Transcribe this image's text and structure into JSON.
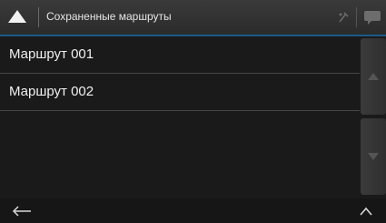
{
  "header": {
    "title": "Сохраненные маршруты",
    "icons": [
      "up-arrow-icon",
      "settings-tool-icon",
      "chat-bubble-icon"
    ]
  },
  "routes": [
    {
      "label": "Маршрут 001"
    },
    {
      "label": "Маршрут 002"
    }
  ],
  "footer": {
    "left_icon": "back-arrow-icon",
    "right_icon": "chevron-up-icon"
  },
  "colors": {
    "accent": "#1c5a86",
    "background": "#1a1a1a"
  }
}
